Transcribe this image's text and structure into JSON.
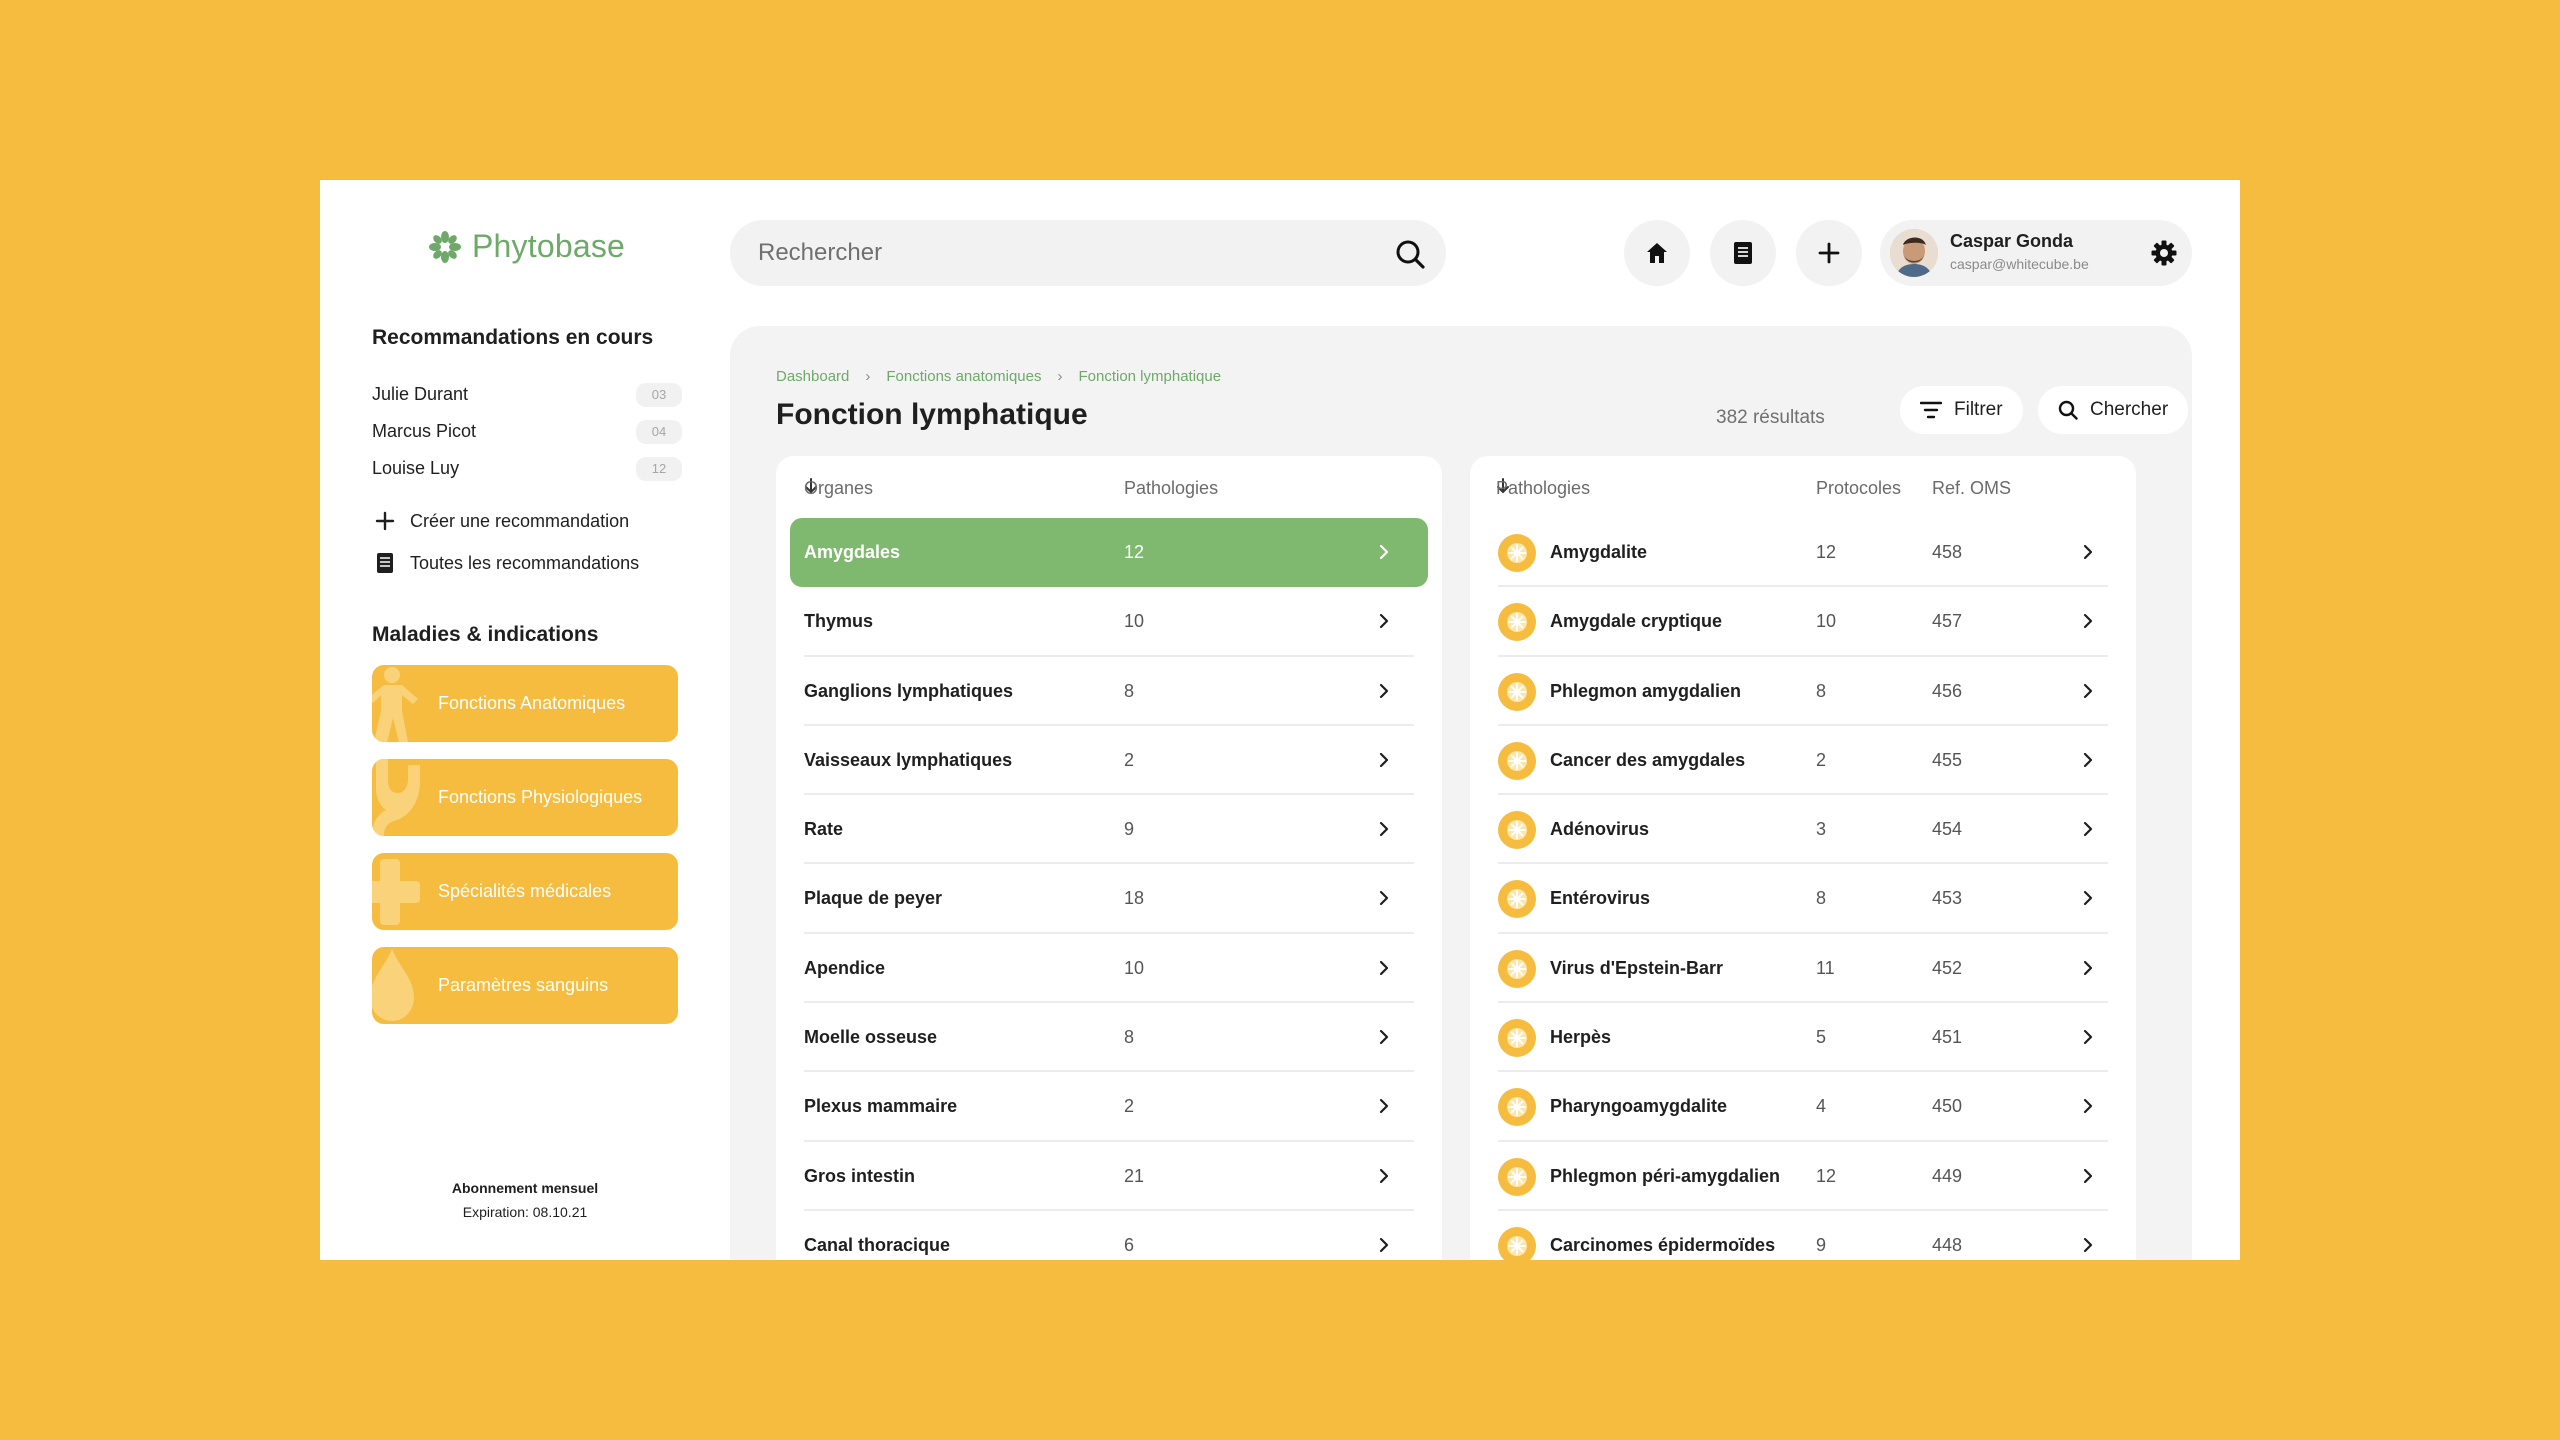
{
  "colors": {
    "background": "#F6BC3F",
    "brand_green": "#6FA96A",
    "active_row": "#7FB86F",
    "category_yellow": "#F6BC3F"
  },
  "brand": {
    "name": "Phytobase",
    "icon": "leaf-cluster-icon"
  },
  "recommendations": {
    "title": "Recommandations en cours",
    "items": [
      {
        "name": "Julie Durant",
        "count": "03"
      },
      {
        "name": "Marcus Picot",
        "count": "04"
      },
      {
        "name": "Louise Luy",
        "count": "12"
      }
    ],
    "create_label": "Créer une recommandation",
    "all_label": "Toutes les recommandations"
  },
  "diseases": {
    "title": "Maladies & indications",
    "categories": [
      {
        "label": "Fonctions Anatomiques",
        "icon": "human-figure-icon"
      },
      {
        "label": "Fonctions Physiologiques",
        "icon": "stomach-icon"
      },
      {
        "label": "Spécialités médicales",
        "icon": "medical-cross-icon"
      },
      {
        "label": "Paramètres sanguins",
        "icon": "blood-drop-icon"
      }
    ]
  },
  "subscription": {
    "title": "Abonnement mensuel",
    "expiration": "Expiration: 08.10.21"
  },
  "search": {
    "placeholder": "Rechercher",
    "value": ""
  },
  "top_actions": [
    "home-icon",
    "book-icon",
    "plus-icon"
  ],
  "user": {
    "name": "Caspar Gonda",
    "email": "caspar@whitecube.be"
  },
  "breadcrumb": [
    "Dashboard",
    "Fonctions anatomiques",
    "Fonction lymphatique"
  ],
  "page": {
    "title": "Fonction lymphatique",
    "results": "382 résultats",
    "filter_label": "Filtrer",
    "search_label": "Chercher"
  },
  "organs_table": {
    "headers": {
      "name": "Organes",
      "count": "Pathologies"
    },
    "selected_index": 0,
    "rows": [
      {
        "name": "Amygdales",
        "count": "12"
      },
      {
        "name": "Thymus",
        "count": "10"
      },
      {
        "name": "Ganglions lymphatiques",
        "count": "8"
      },
      {
        "name": "Vaisseaux lymphatiques",
        "count": "2"
      },
      {
        "name": "Rate",
        "count": "9"
      },
      {
        "name": "Plaque de peyer",
        "count": "18"
      },
      {
        "name": "Apendice",
        "count": "10"
      },
      {
        "name": "Moelle osseuse",
        "count": "8"
      },
      {
        "name": "Plexus mammaire",
        "count": "2"
      },
      {
        "name": "Gros intestin",
        "count": "21"
      },
      {
        "name": "Canal thoracique",
        "count": "6"
      }
    ]
  },
  "pathologies_table": {
    "headers": {
      "name": "Pathologies",
      "protocols": "Protocoles",
      "ref": "Ref. OMS"
    },
    "rows": [
      {
        "name": "Amygdalite",
        "protocols": "12",
        "ref": "458"
      },
      {
        "name": "Amygdale cryptique",
        "protocols": "10",
        "ref": "457"
      },
      {
        "name": "Phlegmon amygdalien",
        "protocols": "8",
        "ref": "456"
      },
      {
        "name": "Cancer des amygdales",
        "protocols": "2",
        "ref": "455"
      },
      {
        "name": "Adénovirus",
        "protocols": "3",
        "ref": "454"
      },
      {
        "name": "Entérovirus",
        "protocols": "8",
        "ref": "453"
      },
      {
        "name": "Virus d'Epstein-Barr",
        "protocols": "11",
        "ref": "452"
      },
      {
        "name": "Herpès",
        "protocols": "5",
        "ref": "451"
      },
      {
        "name": "Pharyngoamygdalite",
        "protocols": "4",
        "ref": "450"
      },
      {
        "name": "Phlegmon péri-amygdalien",
        "protocols": "12",
        "ref": "449"
      },
      {
        "name": "Carcinomes épidermoïdes",
        "protocols": "9",
        "ref": "448"
      }
    ]
  }
}
